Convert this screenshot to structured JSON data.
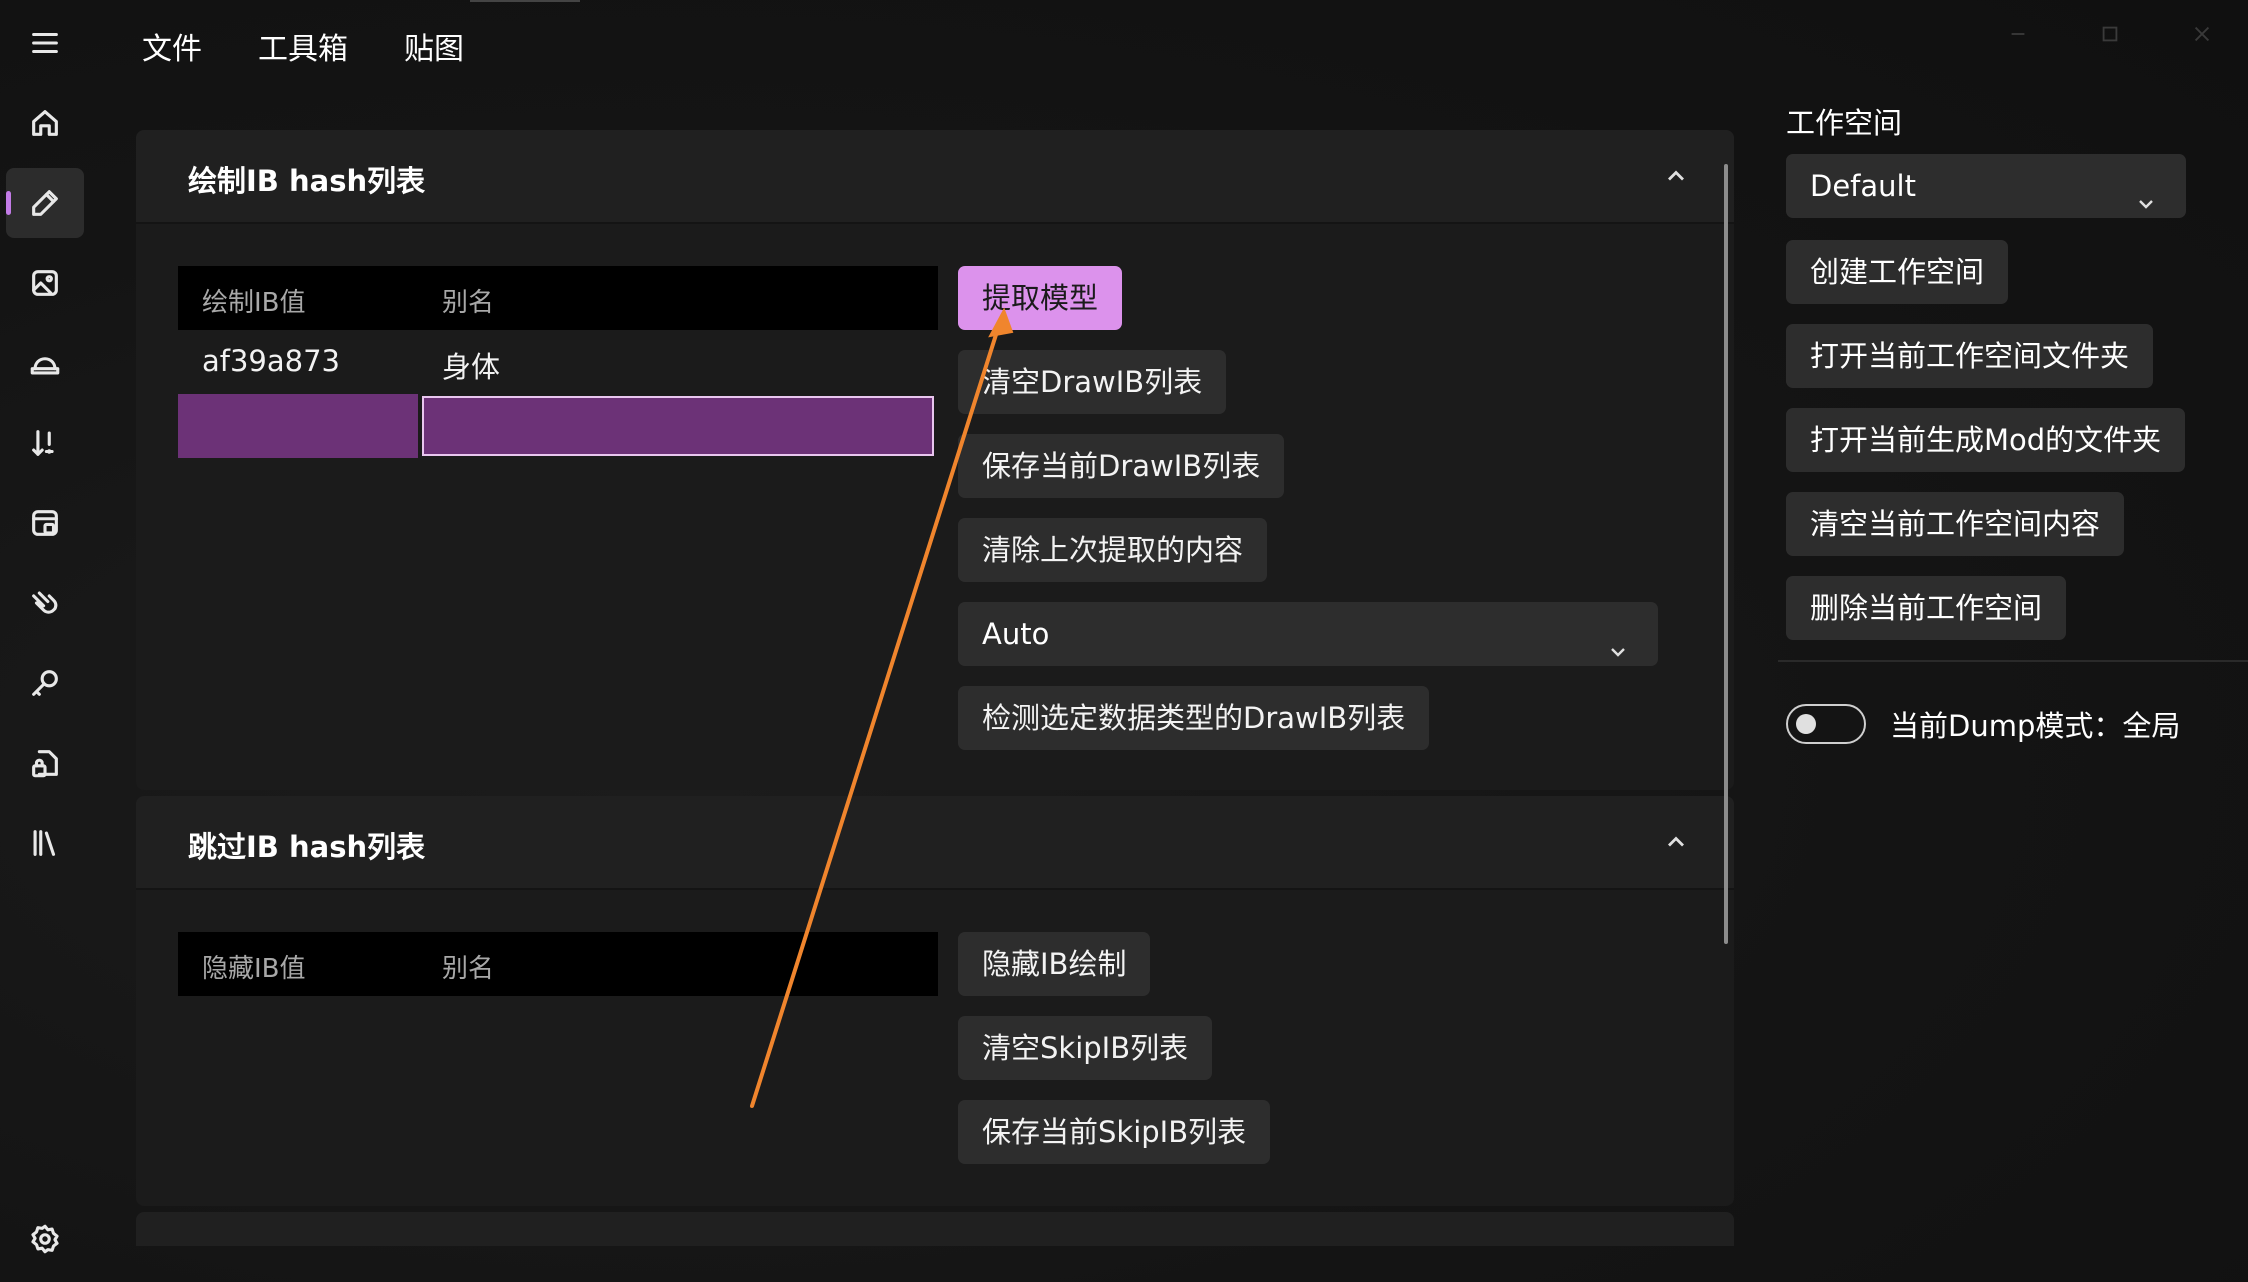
{
  "menu": [
    "文件",
    "工具箱",
    "贴图"
  ],
  "sidebar": {
    "items": [
      {
        "icon": "menu-icon"
      },
      {
        "icon": "home-icon"
      },
      {
        "icon": "pencil-icon",
        "active": true
      },
      {
        "icon": "image-icon"
      },
      {
        "icon": "hat-icon"
      },
      {
        "icon": "sort-icon"
      },
      {
        "icon": "database-icon"
      },
      {
        "icon": "hand-icon"
      },
      {
        "icon": "key-icon"
      },
      {
        "icon": "lock-file-icon"
      },
      {
        "icon": "library-icon"
      },
      {
        "icon": "gear-icon"
      }
    ],
    "accent_color": "#c27be6"
  },
  "drawib_panel": {
    "title": "绘制IB hash列表",
    "columns": [
      "绘制IB值",
      "别名"
    ],
    "rows": [
      {
        "hash": "af39a873",
        "alias": "身体"
      }
    ],
    "buttons": [
      "提取模型",
      "清空DrawIB列表",
      "保存当前DrawIB列表",
      "清除上次提取的内容"
    ],
    "type_select": "Auto",
    "detect_button": "检测选定数据类型的DrawIB列表"
  },
  "skipib_panel": {
    "title": "跳过IB hash列表",
    "columns": [
      "隐藏IB值",
      "别名"
    ],
    "buttons": [
      "隐藏IB绘制",
      "清空SkipIB列表",
      "保存当前SkipIB列表"
    ]
  },
  "workspace": {
    "title": "工作空间",
    "selected": "Default",
    "buttons": [
      "创建工作空间",
      "打开当前工作空间文件夹",
      "打开当前生成Mod的文件夹",
      "清空当前工作空间内容",
      "删除当前工作空间"
    ],
    "dump_mode_label": "当前Dump模式：全局",
    "dump_toggle_on": false
  },
  "colors": {
    "accent_button": "#dc92ec",
    "edit_cell": "#6c3277",
    "annotation_arrow": "#f0852d"
  }
}
